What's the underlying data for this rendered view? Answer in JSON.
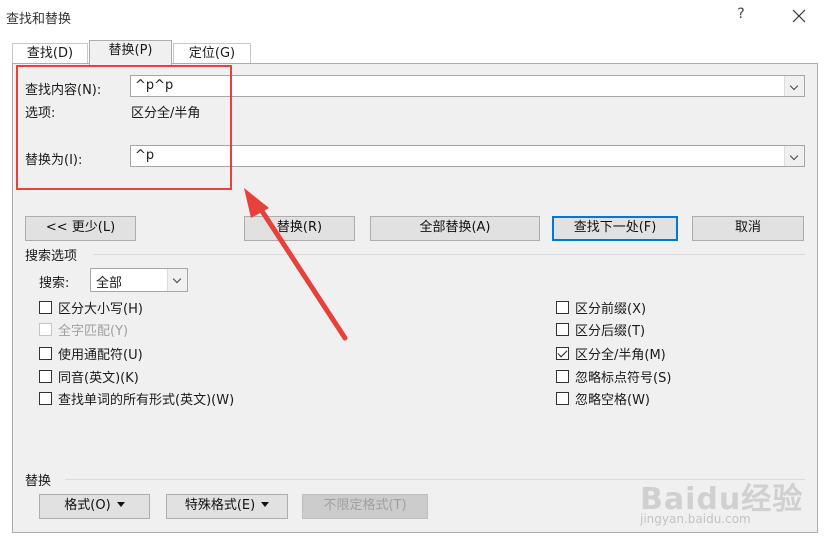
{
  "window": {
    "title": "查找和替换",
    "help_label": "?",
    "close_icon": "close-icon"
  },
  "tabs": [
    {
      "label": "查找(D)"
    },
    {
      "label": "替换(P)",
      "active": true
    },
    {
      "label": "定位(G)"
    }
  ],
  "find": {
    "label": "查找内容(N):",
    "value": "^p^p",
    "options_label": "选项:",
    "options_value": "区分全/半角"
  },
  "replace": {
    "label": "替换为(I):",
    "value": "^p"
  },
  "buttons": {
    "less": "<< 更少(L)",
    "replace": "替换(R)",
    "replace_all": "全部替换(A)",
    "find_next": "查找下一处(F)",
    "cancel": "取消"
  },
  "search_options": {
    "title": "搜索选项",
    "search_label": "搜索:",
    "search_value": "全部",
    "left": [
      {
        "label": "区分大小写(H)",
        "checked": false,
        "disabled": false
      },
      {
        "label": "全字匹配(Y)",
        "checked": false,
        "disabled": true
      },
      {
        "label": "使用通配符(U)",
        "checked": false,
        "disabled": false
      },
      {
        "label": "同音(英文)(K)",
        "checked": false,
        "disabled": false
      },
      {
        "label": "查找单词的所有形式(英文)(W)",
        "checked": false,
        "disabled": false
      }
    ],
    "right": [
      {
        "label": "区分前缀(X)",
        "checked": false
      },
      {
        "label": "区分后缀(T)",
        "checked": false
      },
      {
        "label": "区分全/半角(M)",
        "checked": true
      },
      {
        "label": "忽略标点符号(S)",
        "checked": false
      },
      {
        "label": "忽略空格(W)",
        "checked": false
      }
    ]
  },
  "replace_section": {
    "title": "替换",
    "format": "格式(O)",
    "special": "特殊格式(E)",
    "no_format": "不限定格式(T)"
  },
  "watermark": {
    "brand": "Baidu经验",
    "url": "jingyan.baidu.com"
  },
  "colors": {
    "annotation": "#e8413b",
    "default_button_border": "#0078d7"
  }
}
